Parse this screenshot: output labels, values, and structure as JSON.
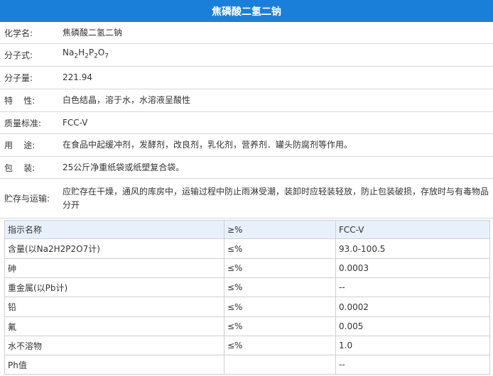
{
  "title": "焦磷酸二氢二钠",
  "info": [
    {
      "label": "化学名:",
      "value": "焦磷酸二氢二钠"
    },
    {
      "label": "分子式:",
      "value": "Na2H2P2O7"
    },
    {
      "label": "分子量:",
      "value": "221.94"
    },
    {
      "label": "特    性:",
      "value": "白色结晶，溶于水，水溶液呈酸性"
    },
    {
      "label": "质量标准:",
      "value": "FCC-V"
    },
    {
      "label": "用    途:",
      "value": "在食品中起缓冲剂，发酵剂，改良剂，乳化剂，营养剂．罐头防腐剂等作用。"
    },
    {
      "label": "包    装:",
      "value": "25公斤净重纸袋或纸塑复合袋。"
    },
    {
      "label": "贮存与运输:",
      "value": "应贮存在干燥，通风的库房中，运输过程中防止雨淋受潮，装卸时应轻装轻放，防止包装破损，存放时与有毒物品分开"
    }
  ],
  "formula": {
    "p1": "Na",
    "s1": "2",
    "p2": "H",
    "s2": "2",
    "p3": "P",
    "s3": "2",
    "p4": "O",
    "s4": "7"
  },
  "spec_table": {
    "headers": [
      "指示名称",
      "≥%",
      "FCC-V"
    ],
    "rows": [
      {
        "name": "含量(以Na2H2P2O7计)",
        "op": "≤%",
        "value": "93.0-100.5"
      },
      {
        "name": "砷",
        "op": "≤%",
        "value": "0.0003"
      },
      {
        "name": "重金属(以Pb计)",
        "op": "≤%",
        "value": "--"
      },
      {
        "name": "铅",
        "op": "≤%",
        "value": "0.0002"
      },
      {
        "name": "氟",
        "op": "≤%",
        "value": "0.005"
      },
      {
        "name": "水不溶物",
        "op": "≤%",
        "value": "1.0"
      },
      {
        "name": "Ph值",
        "op": "",
        "value": "--"
      }
    ]
  },
  "colors": {
    "title_bg": "#1a7fd9",
    "header_bg": "#e8f1fb",
    "border": "#cfcfcf"
  }
}
